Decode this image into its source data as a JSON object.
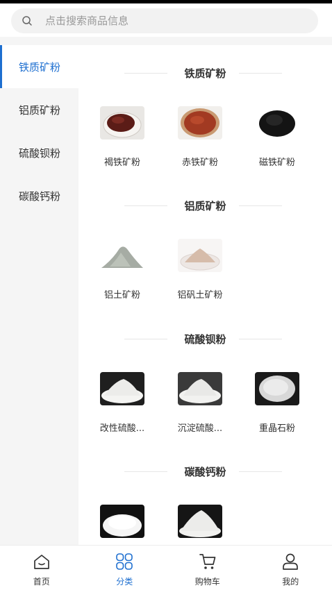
{
  "search": {
    "placeholder": "点击搜索商品信息"
  },
  "sidebar": {
    "items": [
      {
        "label": "铁质矿粉"
      },
      {
        "label": "铝质矿粉"
      },
      {
        "label": "硫酸钡粉"
      },
      {
        "label": "碳酸钙粉"
      }
    ],
    "active_index": 0
  },
  "sections": [
    {
      "title": "铁质矿粉",
      "items": [
        {
          "name": "褐铁矿粉"
        },
        {
          "name": "赤铁矿粉"
        },
        {
          "name": "磁铁矿粉"
        }
      ]
    },
    {
      "title": "铝质矿粉",
      "items": [
        {
          "name": "铝土矿粉"
        },
        {
          "name": "铝矾土矿粉"
        }
      ]
    },
    {
      "title": "硫酸钡粉",
      "items": [
        {
          "name": "改性硫酸..."
        },
        {
          "name": "沉淀硫酸..."
        },
        {
          "name": "重晶石粉"
        }
      ]
    },
    {
      "title": "碳酸钙粉",
      "items": [
        {
          "name": ""
        },
        {
          "name": ""
        }
      ]
    }
  ],
  "tabbar": {
    "items": [
      {
        "label": "首页",
        "icon": "home-icon"
      },
      {
        "label": "分类",
        "icon": "category-icon"
      },
      {
        "label": "购物车",
        "icon": "cart-icon"
      },
      {
        "label": "我的",
        "icon": "user-icon"
      }
    ],
    "active_index": 1
  },
  "colors": {
    "accent": "#1e6fd0",
    "sidebar_bg": "#f5f5f5",
    "text": "#333333",
    "placeholder": "#999999"
  }
}
